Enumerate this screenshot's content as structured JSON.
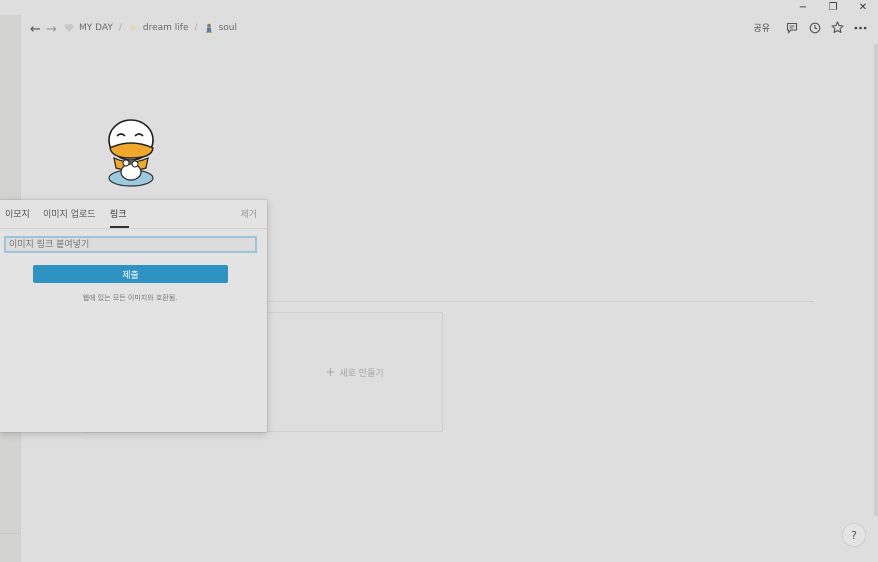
{
  "window": {
    "minimize": "−",
    "restore": "❐",
    "close": "✕"
  },
  "nav": {
    "back": "←",
    "forward": "→"
  },
  "breadcrumbs": [
    {
      "label": "MY DAY",
      "icon": "heart-icon"
    },
    {
      "label": "dream life",
      "icon": "sparkle-icon"
    },
    {
      "label": "soul",
      "icon": "statue-icon"
    }
  ],
  "breadcrumb_separator": "/",
  "topbar": {
    "share_label": "공유",
    "icons": [
      "comment-icon",
      "clock-icon",
      "star-icon",
      "more-icon"
    ]
  },
  "page": {
    "cover_icon": "duck-character-icon",
    "new_card_plus": "+",
    "new_card_label": "새로 만들기"
  },
  "icon_picker": {
    "tabs": [
      {
        "label": "이모지",
        "active": false
      },
      {
        "label": "이미지 업로드",
        "active": false
      },
      {
        "label": "링크",
        "active": true
      }
    ],
    "remove_label": "제거",
    "link_input_placeholder": "이미지 링크 붙여넣기",
    "submit_label": "제출",
    "hint": "웹에 있는 모든 이미지와 호환됨."
  },
  "help_label": "?",
  "colors": {
    "accent": "#2e92c2",
    "background": "#dedede",
    "popup": "#e3e3e3"
  }
}
